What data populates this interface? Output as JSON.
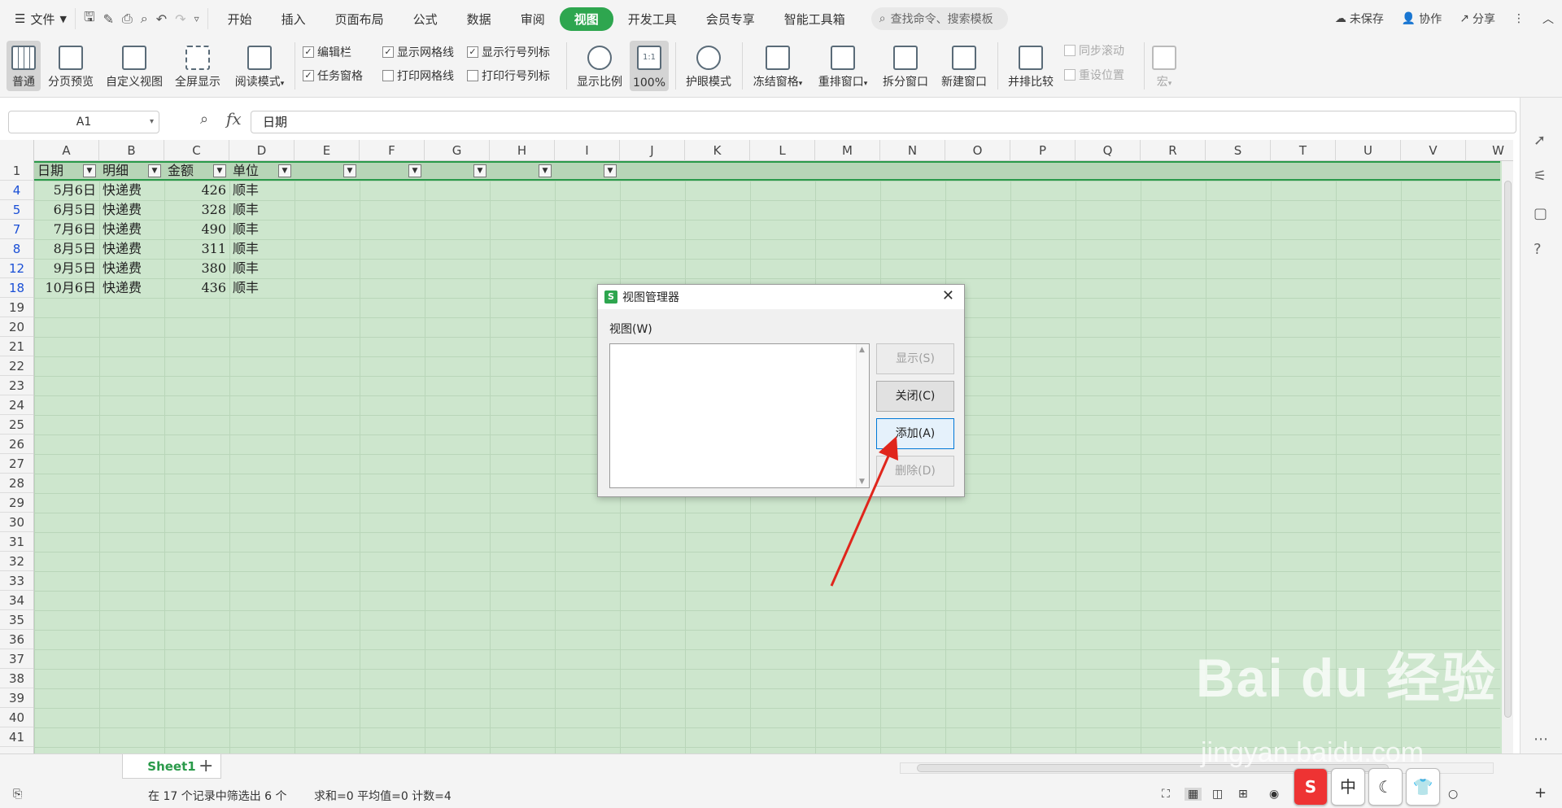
{
  "menubar": {
    "file_label": "文件",
    "tabs": [
      "开始",
      "插入",
      "页面布局",
      "公式",
      "数据",
      "审阅",
      "视图",
      "开发工具",
      "会员专享",
      "智能工具箱"
    ],
    "active_tab": "视图",
    "search_placeholder": "查找命令、搜索模板",
    "unsaved": "未保存",
    "collab": "协作",
    "share": "分享"
  },
  "ribbon": {
    "normal": "普通",
    "page_break": "分页预览",
    "custom_view": "自定义视图",
    "fullscreen": "全屏显示",
    "reading_mode": "阅读模式",
    "edit_bar": "编辑栏",
    "task_pane": "任务窗格",
    "show_gridlines": "显示网格线",
    "print_gridlines": "打印网格线",
    "show_headers": "显示行号列标",
    "print_headers": "打印行号列标",
    "zoom_ratio": "显示比例",
    "zoom_100": "100%",
    "zoom_100_icon": "1:1",
    "eye_mode": "护眼模式",
    "freeze": "冻结窗格",
    "rearrange": "重排窗口",
    "split": "拆分窗口",
    "new_window": "新建窗口",
    "compare": "并排比较",
    "sync_scroll": "同步滚动",
    "reset_pos": "重设位置",
    "macro": "宏"
  },
  "formula_bar": {
    "cell_ref": "A1",
    "fx": "fx",
    "value": "日期"
  },
  "sheet": {
    "columns": [
      "A",
      "B",
      "C",
      "D",
      "E",
      "F",
      "G",
      "H",
      "I",
      "J",
      "K",
      "L",
      "M",
      "N",
      "O",
      "P",
      "Q",
      "R",
      "S",
      "T",
      "U",
      "V",
      "W"
    ],
    "header_row": {
      "num": "1",
      "cells": [
        "日期",
        "明细",
        "金额",
        "单位"
      ]
    },
    "rows": [
      {
        "num": "4",
        "date": "5月6日",
        "detail": "快递费",
        "amount": "426",
        "unit": "顺丰"
      },
      {
        "num": "5",
        "date": "6月5日",
        "detail": "快递费",
        "amount": "328",
        "unit": "顺丰"
      },
      {
        "num": "7",
        "date": "7月6日",
        "detail": "快递费",
        "amount": "490",
        "unit": "顺丰"
      },
      {
        "num": "8",
        "date": "8月5日",
        "detail": "快递费",
        "amount": "311",
        "unit": "顺丰"
      },
      {
        "num": "12",
        "date": "9月5日",
        "detail": "快递费",
        "amount": "380",
        "unit": "顺丰"
      },
      {
        "num": "18",
        "date": "10月6日",
        "detail": "快递费",
        "amount": "436",
        "unit": "顺丰"
      }
    ],
    "empty_rows": [
      "19",
      "20",
      "21",
      "22",
      "23",
      "24",
      "25",
      "26",
      "27",
      "28",
      "29",
      "30",
      "31",
      "32",
      "33",
      "34",
      "35",
      "36",
      "37",
      "38",
      "39",
      "40",
      "41"
    ],
    "tab_name": "Sheet1"
  },
  "status": {
    "filter_info": "在 17 个记录中筛选出 6 个",
    "stats": "求和=0  平均值=0  计数=4"
  },
  "ime": [
    "S",
    "中",
    "☾",
    "👕"
  ],
  "dialog": {
    "title": "视图管理器",
    "list_label": "视图(W)",
    "btn_show": "显示(S)",
    "btn_close": "关闭(C)",
    "btn_add": "添加(A)",
    "btn_delete": "删除(D)"
  },
  "watermark": {
    "logo": "Bai du 经验",
    "url": "jingyan.baidu.com"
  },
  "colors": {
    "accent": "#2ea64f",
    "sheet_bg": "#cde6cd",
    "filtered_row": "#1a4fd6",
    "arrow": "#e0261c"
  }
}
